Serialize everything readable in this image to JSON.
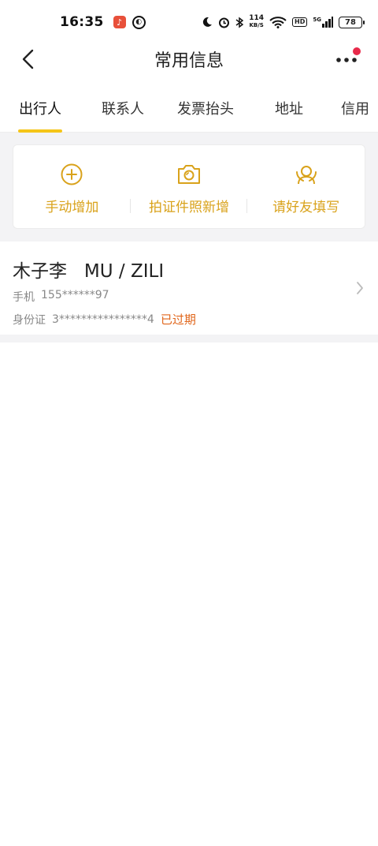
{
  "status_bar": {
    "time": "16:35",
    "net_speed_value": "114",
    "net_speed_unit": "KB/S",
    "hd_label": "HD",
    "signal_label": "5G",
    "battery": "78"
  },
  "nav": {
    "title": "常用信息"
  },
  "tabs": [
    {
      "label": "出行人",
      "active": true
    },
    {
      "label": "联系人",
      "active": false
    },
    {
      "label": "发票抬头",
      "active": false
    },
    {
      "label": "地址",
      "active": false
    },
    {
      "label": "信用",
      "active": false
    }
  ],
  "actions": [
    {
      "label": "手动增加",
      "icon": "plus-circle-icon"
    },
    {
      "label": "拍证件照新增",
      "icon": "camera-icon"
    },
    {
      "label": "请好友填写",
      "icon": "friend-icon"
    }
  ],
  "traveler": {
    "name": "木子李   MU / ZILI",
    "phone_label": "手机",
    "phone_value": "155******97",
    "id_label": "身份证",
    "id_value": "3****************4",
    "status": "已过期"
  },
  "colors": {
    "accent": "#f5c518",
    "action_text": "#d9a21b",
    "expired": "#e0651a",
    "notify_dot": "#e82a4a",
    "page_bg": "#f3f3f5"
  }
}
